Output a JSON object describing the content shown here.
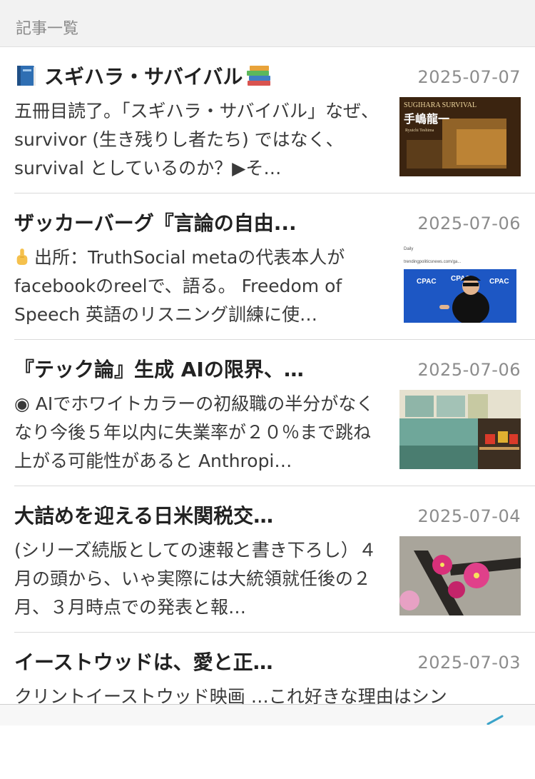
{
  "header": {
    "title": "記事一覧"
  },
  "articles": [
    {
      "title": "スギハラ・サバイバル",
      "date": "2025-07-07",
      "excerpt": "五冊目読了。「スギハラ・サバイバル」なぜ、survivor (生き残りし者たち) ではなく、survival としているのか？▶そ…",
      "thumb_title": "SUGIHARA SURVIVAL",
      "thumb_author": "手嶋龍一",
      "thumb_author_en": "Ryuichi Teshima",
      "icons": [
        "blue-book-icon",
        "books-icon"
      ]
    },
    {
      "title": "ザッカーバーグ『言論の自由...",
      "date": "2025-07-06",
      "excerpt": "出所：TruthSocial metaの代表本人がfacebookのreelで、語る。 Freedom of Speech 英語のリスニング訓練に使…",
      "thumb_caption_1": "Daily",
      "thumb_caption_2": "trendingpoliticsnews.com/ga...",
      "thumb_logo": "CPAC",
      "icons": [
        "pointing-finger-icon"
      ]
    },
    {
      "title": "『テック論』生成 AIの限界、…",
      "date": "2025-07-06",
      "excerpt": "◉ AIでホワイトカラーの初級職の半分がなくなり今後５年以内に失業率が２０％まで跳ね上がる可能性があると Anthropi…"
    },
    {
      "title": "大詰めを迎える日米関税交…",
      "date": "2025-07-04",
      "excerpt": "(シリーズ続版としての速報と書き下ろし）４月の頭から、いゃ実際には大統領就任後の２月、３月時点での発表と報…"
    },
    {
      "title": "イーストウッドは、愛と正…",
      "date": "2025-07-03",
      "excerpt": "クリントイーストウッド映画 …これ好きな理由はシン"
    }
  ],
  "colors": {
    "accent": "#3aa3c9",
    "date": "#8c8c8c",
    "header_bg": "#f2f2f2"
  }
}
